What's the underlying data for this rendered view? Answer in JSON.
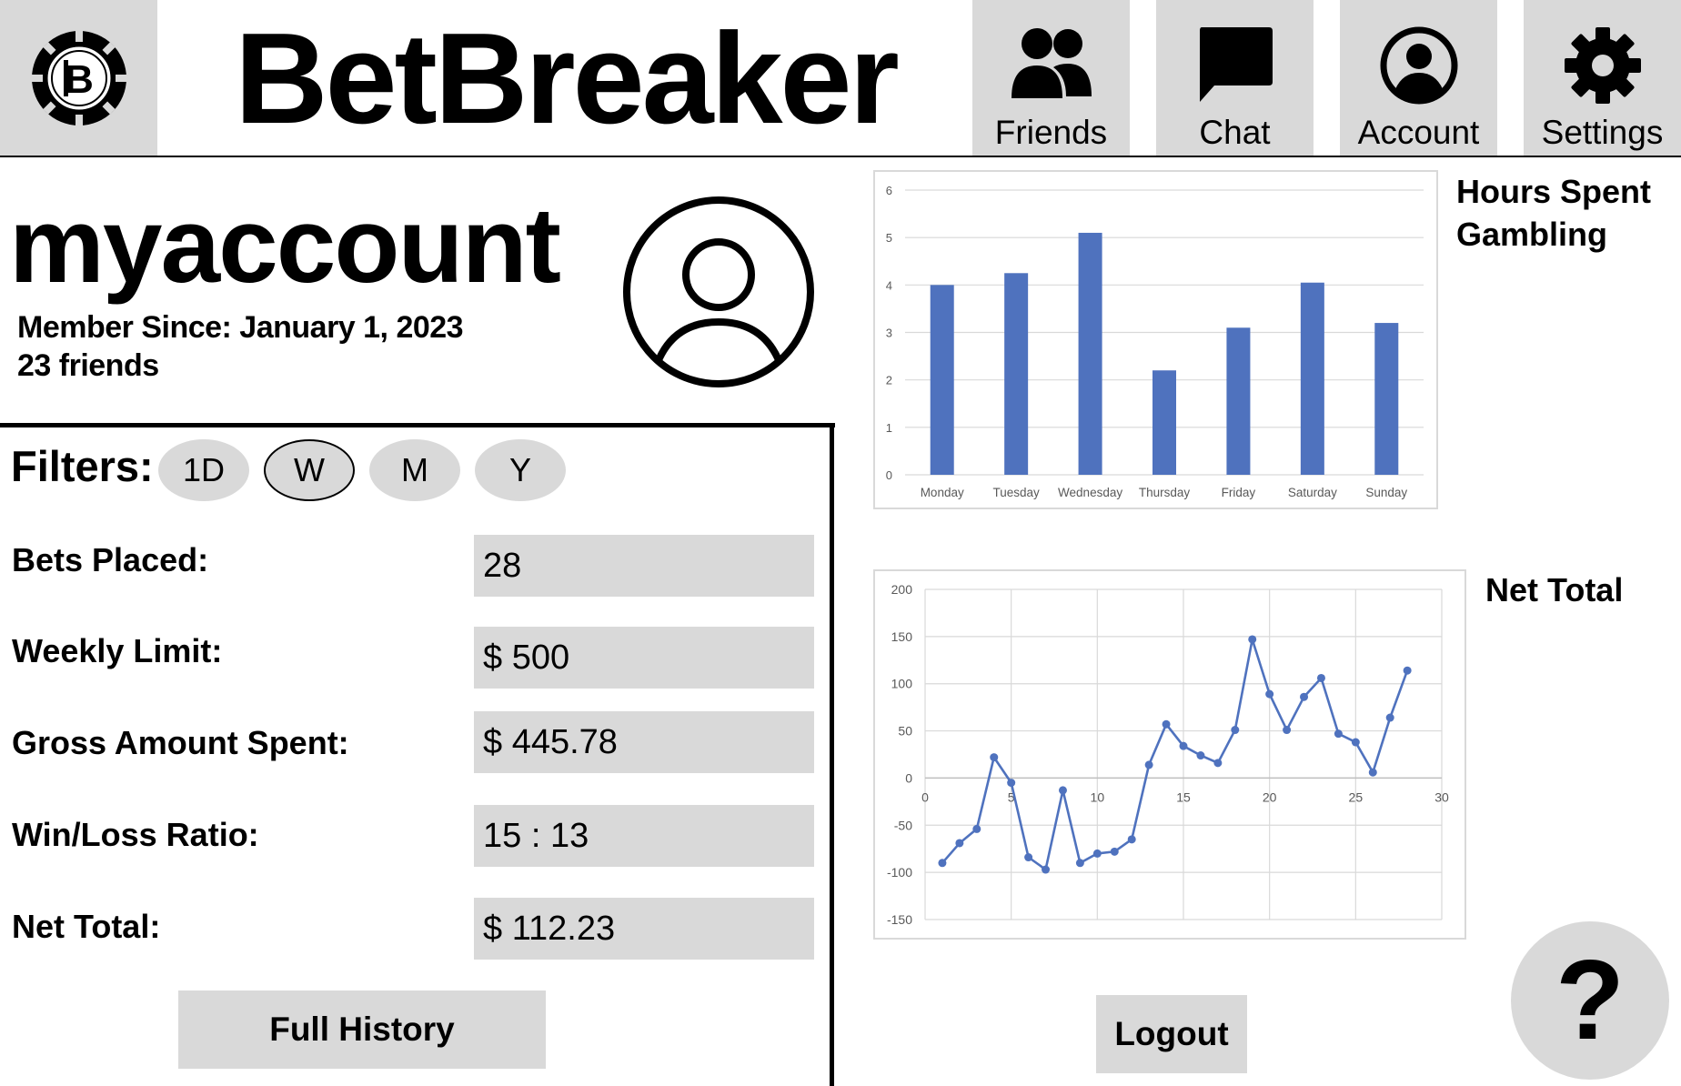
{
  "header": {
    "app_title": "BetBreaker",
    "nav": [
      {
        "label": "Friends",
        "icon": "friends-icon"
      },
      {
        "label": "Chat",
        "icon": "chat-icon"
      },
      {
        "label": "Account",
        "icon": "account-icon"
      },
      {
        "label": "Settings",
        "icon": "gear-icon"
      }
    ]
  },
  "profile": {
    "username": "myaccount",
    "member_since": "Member Since: January 1, 2023",
    "friends_count": "23 friends"
  },
  "filters": {
    "label": "Filters:",
    "options": [
      "1D",
      "W",
      "M",
      "Y"
    ],
    "selected": "W"
  },
  "stats": [
    {
      "label": "Bets Placed:",
      "value": "28"
    },
    {
      "label": "Weekly Limit:",
      "value": "$ 500"
    },
    {
      "label": "Gross Amount Spent:",
      "value": "$ 445.78"
    },
    {
      "label": "Win/Loss Ratio:",
      "value": "15 : 13"
    },
    {
      "label": "Net Total:",
      "value": "$ 112.23"
    }
  ],
  "buttons": {
    "full_history": "Full History",
    "logout": "Logout",
    "help": "?"
  },
  "colors": {
    "tile_gray": "#d9d9d9",
    "series_blue": "#4f72be"
  },
  "chart_data": [
    {
      "type": "bar",
      "title": "Hours Spent Gambling",
      "categories": [
        "Monday",
        "Tuesday",
        "Wednesday",
        "Thursday",
        "Friday",
        "Saturday",
        "Sunday"
      ],
      "values": [
        4.0,
        4.25,
        5.1,
        2.2,
        3.1,
        4.05,
        3.2
      ],
      "yticks": [
        "0",
        "1",
        "2",
        "3",
        "4",
        "5",
        "6"
      ],
      "ylim": [
        0,
        6
      ],
      "grid": true,
      "legend": "none"
    },
    {
      "type": "line",
      "title": "Net Total",
      "x": [
        1,
        2,
        3,
        4,
        5,
        6,
        7,
        8,
        9,
        10,
        11,
        12,
        13,
        14,
        15,
        16,
        17,
        18,
        19,
        20,
        21,
        22,
        23,
        24,
        25,
        26,
        27,
        28
      ],
      "values": [
        -90,
        -69,
        -54,
        22,
        -5,
        -84,
        -97,
        -13,
        -90,
        -80,
        -78,
        -65,
        14,
        57,
        34,
        24,
        16,
        51,
        147,
        89,
        51,
        86,
        106,
        47,
        38,
        6,
        64,
        114
      ],
      "xticks": [
        "0",
        "5",
        "10",
        "15",
        "20",
        "25",
        "30"
      ],
      "yticks": [
        "200",
        "150",
        "100",
        "50",
        "0",
        "-50",
        "-100",
        "-150"
      ],
      "xlim": [
        0,
        30
      ],
      "ylim": [
        -150,
        200
      ],
      "grid": true,
      "markers": true,
      "legend": "none"
    }
  ]
}
